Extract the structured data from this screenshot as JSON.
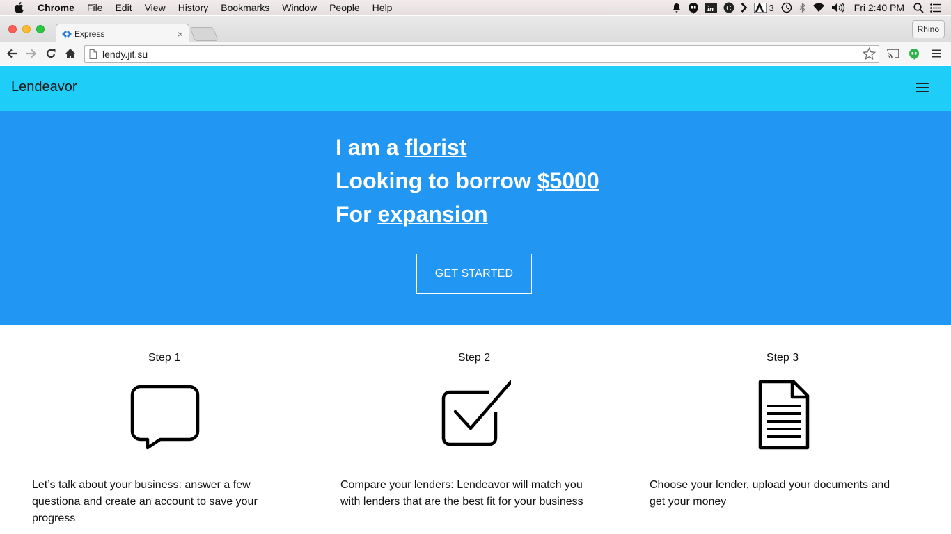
{
  "menubar": {
    "items": [
      "Chrome",
      "File",
      "Edit",
      "View",
      "History",
      "Bookmarks",
      "Window",
      "People",
      "Help"
    ],
    "tray_count": "3",
    "clock": "Fri 2:40 PM"
  },
  "browser": {
    "tab_title": "Express",
    "profile": "Rhino",
    "url": "lendy.jit.su"
  },
  "site": {
    "brand": "Lendeavor",
    "hero": {
      "line1_prefix": "I am a ",
      "line1_link": "florist",
      "line2_prefix": "Looking to borrow ",
      "line2_link": "$5000",
      "line3_prefix": "For ",
      "line3_link": "expansion",
      "cta": "GET STARTED"
    },
    "steps": [
      {
        "title": "Step 1",
        "icon": "speech-bubble-icon",
        "text": "Let’s talk about your business: answer a few questiona and create an account to save your progress"
      },
      {
        "title": "Step 2",
        "icon": "checkbox-icon",
        "text": "Compare your lenders: Lendeavor will match you with lenders that are the best fit for your business"
      },
      {
        "title": "Step 3",
        "icon": "document-icon",
        "text": "Choose your lender, upload your documents and get your money"
      }
    ]
  },
  "colors": {
    "navbar": "#1ecef8",
    "hero": "#2196f3"
  }
}
